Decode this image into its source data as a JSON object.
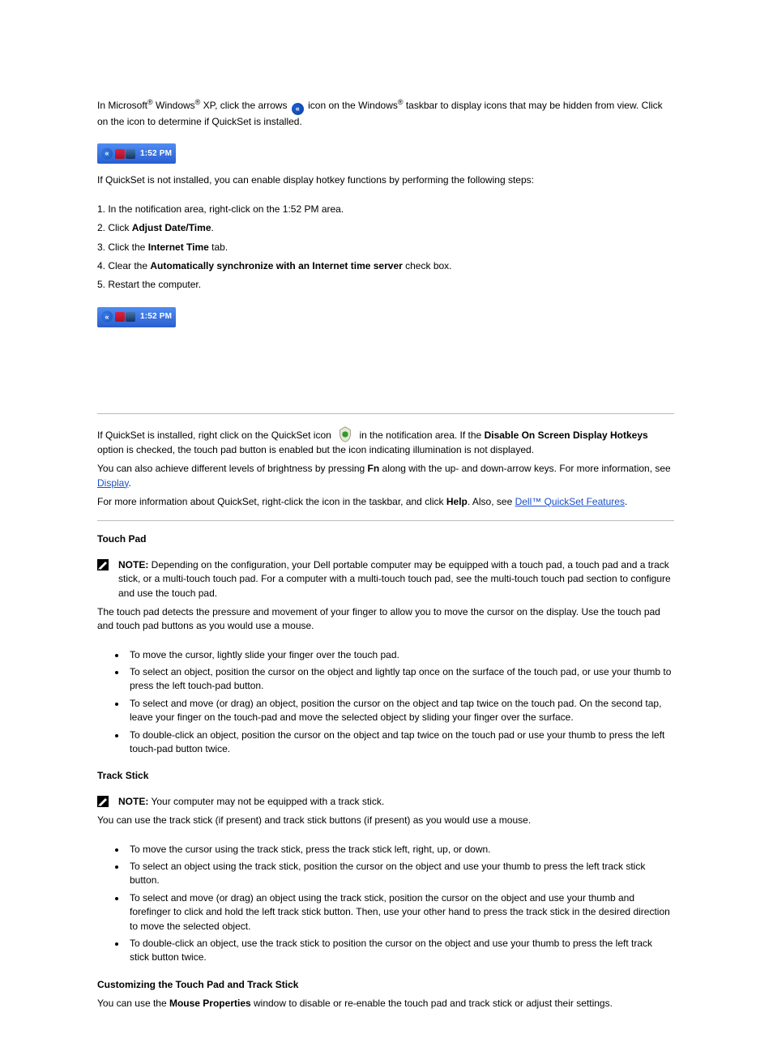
{
  "intro": {
    "sentence_prefix": "In Microsoft",
    "sentence_mid": " Windows",
    "sentence_after_reg": " XP, click the arrows ",
    "sentence_after_chevron": " icon on the Windows",
    "sentence_end": " taskbar to display icons that may be hidden from view. Click on the icon to determine if QuickSet is installed."
  },
  "tray_time": "1:52 PM",
  "para_if_not_installed": "If QuickSet is not installed, you can enable display hotkey functions by performing the following steps:",
  "steps1": {
    "s1": "1. In the notification area, right-click on the 1:52 PM area.",
    "s2_pre": "2. Click ",
    "s2_bold": "Adjust Date/Time",
    "s2_post": ".",
    "s3_pre": "3. Click the ",
    "s3_bold": "Internet Time",
    "s3_post": " tab.",
    "s4_pre": "4. Clear the ",
    "s4_bold": "Automatically synchronize with an Internet time server",
    "s4_post": " check box.",
    "s5": "5. Restart the computer."
  },
  "quickset_para": {
    "pre": "If QuickSet is installed, right click on the QuickSet icon ",
    "mid": " in the notification area. If the ",
    "bold": "Disable On Screen Display Hotkeys",
    "post": " option is checked, the touch pad button is enabled but the icon indicating illumination is not displayed."
  },
  "also_para_pre": "You can also achieve different levels of brightness by pressing ",
  "also_bold": "Fn",
  "also_para_mid": " along with the up- and down-arrow keys. For more information, see ",
  "link1": "Display",
  "also_para_post": ".",
  "more_para_pre": "For more information about QuickSet, right-click the icon in the taskbar, and click ",
  "more_bold": "Help",
  "more_para_post": ". Also, see ",
  "link2": "Dell™ QuickSet Features",
  "more_para_post2": ".",
  "section_touchpad": {
    "heading": "Touch Pad",
    "note_label": "NOTE:",
    "note_text": " Depending on the configuration, your Dell portable computer may be equipped with a touch pad, a touch pad and a track stick, or a multi-touch touch pad. For a computer with a multi-touch touch pad, see the multi-touch touch pad section to configure and use the touch pad.",
    "para1": "The touch pad detects the pressure and movement of your finger to allow you to move the cursor on the display. Use the touch pad and touch pad buttons as you would use a mouse.",
    "bullets": {
      "b1": "To move the cursor, lightly slide your finger over the touch pad.",
      "b2_pre": "To select an object, position the cursor on the object and lightly tap once on the surface of the touch pad, or use your thumb to press the left touch",
      "b2_dash": "-",
      "b2_post": "pad button.",
      "b3_pre": "To select and move (or drag) an object, position the cursor on the object and tap twice on the touch pad. On the second tap, leave your finger on the touch",
      "b3_dash": "-",
      "b3_post": "pad and move the selected object by sliding your finger over the surface.",
      "b4": "To double-click an object, position the cursor on the object and tap twice on the touch pad or use your thumb to press the left touch-pad button twice."
    }
  },
  "section_trackstick": {
    "heading": "Track Stick",
    "note_label": "NOTE:",
    "note_text": " Your computer may not be equipped with a track stick.",
    "para1": "You can use the track stick (if present) and track stick buttons (if present) as you would use a mouse.",
    "bullets": {
      "b1": "To move the cursor using the track stick, press the track stick left, right, up, or down.",
      "b2": "To select an object using the track stick, position the cursor on the object and use your thumb to press the left track stick button.",
      "b3": "To select and move (or drag) an object using the track stick, position the cursor on the object and use your thumb and forefinger to click and hold the left track stick button. Then, use your other hand to press the track stick in the desired direction to move the selected object.",
      "b4": "To double-click an object, use the track stick to position the cursor on the object and use your thumb to press the left track stick button twice."
    },
    "customize_heading": "Customizing the Touch Pad and Track Stick",
    "customize_para_pre": "You can use the ",
    "customize_bold": "Mouse Properties",
    "customize_para_post": " window to disable or re-enable the touch pad and track stick or adjust their settings."
  }
}
